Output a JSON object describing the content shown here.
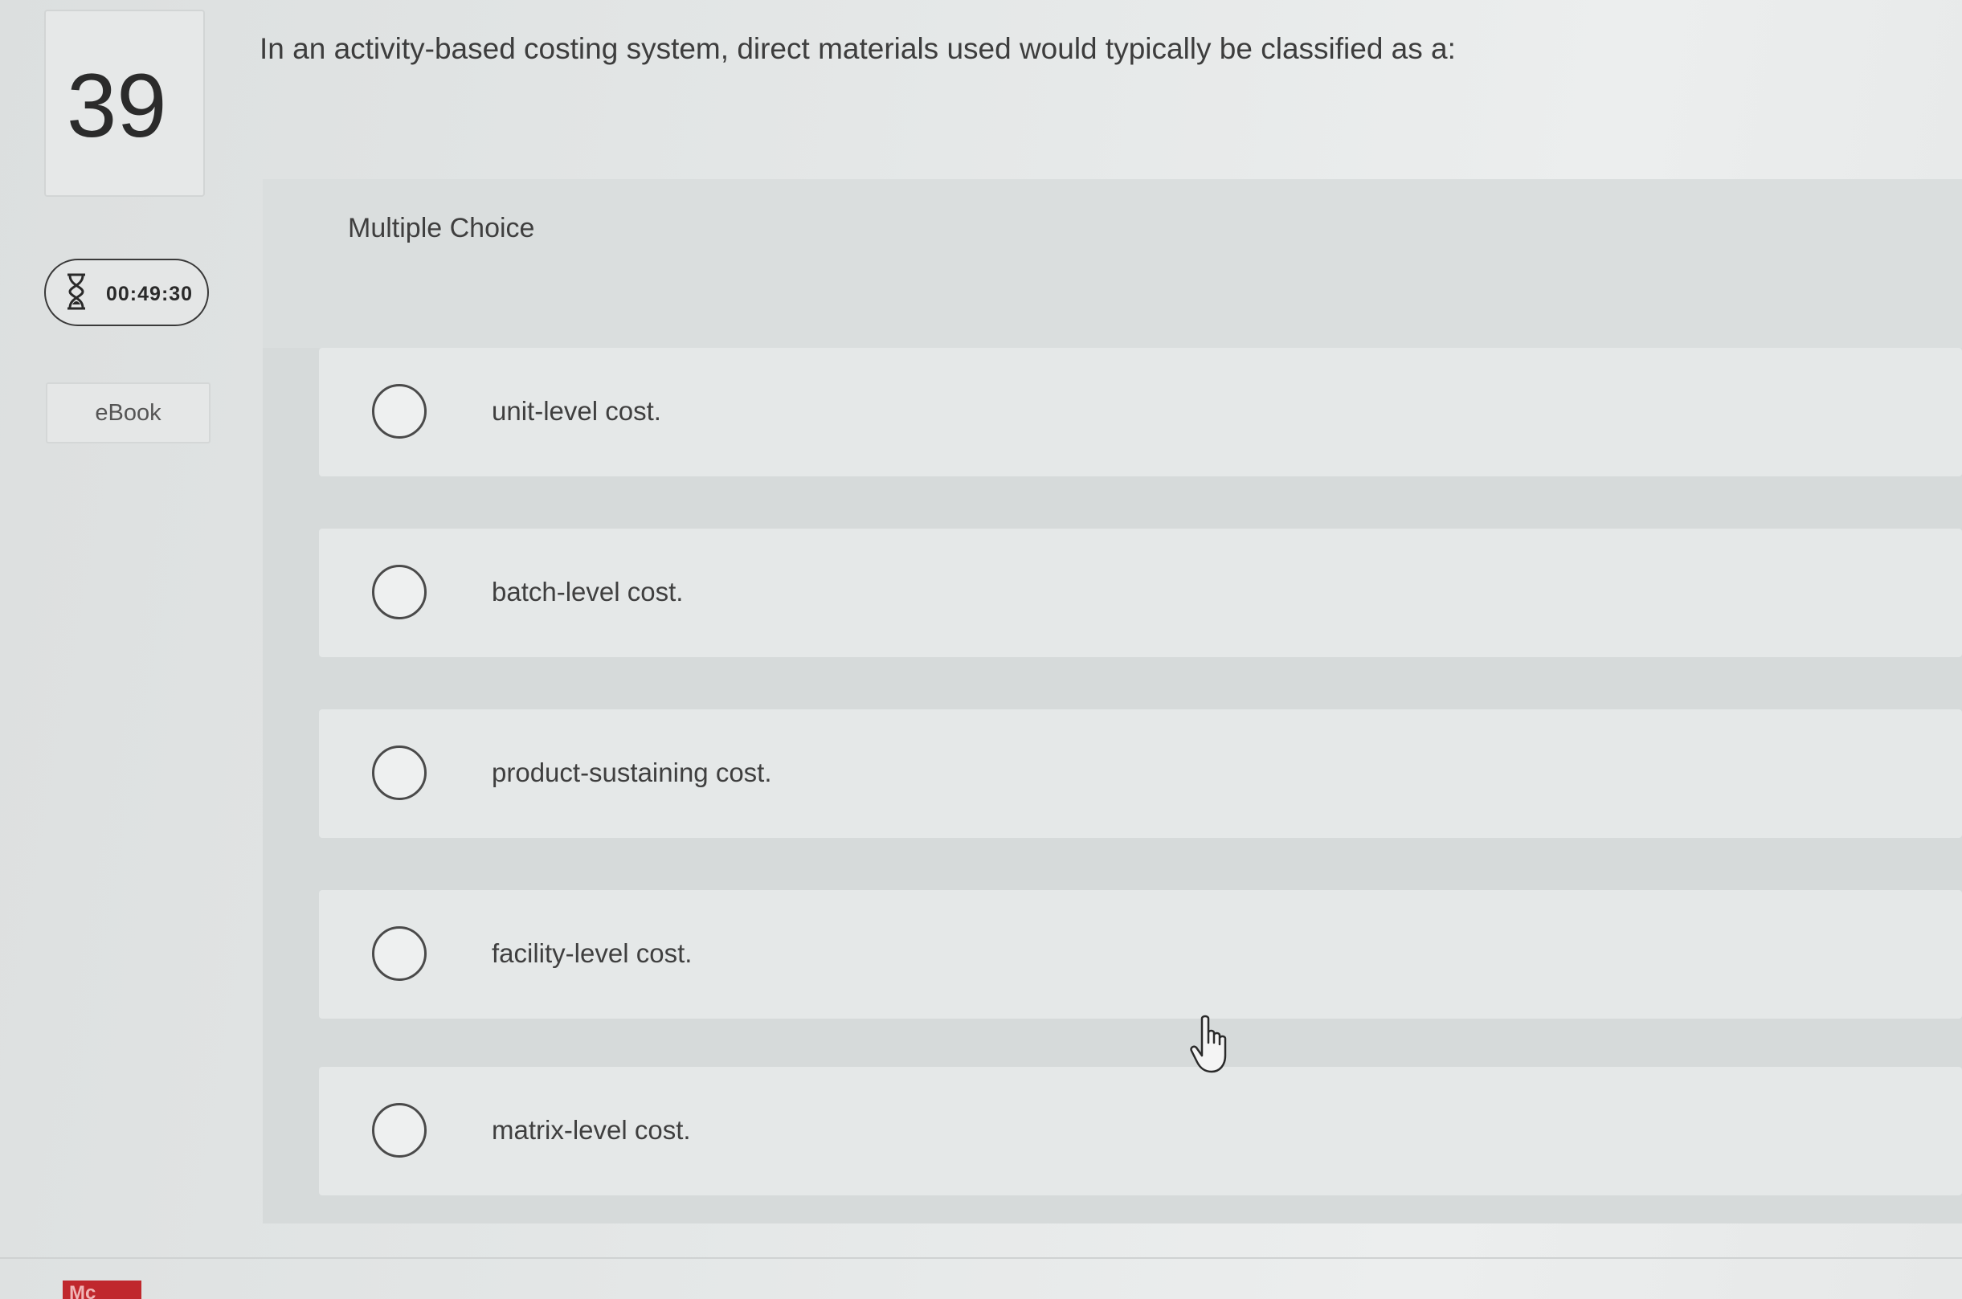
{
  "question": {
    "number": "39",
    "text": "In an activity-based costing system, direct materials used would typically be classified as a:"
  },
  "timer": {
    "icon": "hourglass-icon",
    "value": "00:49:30"
  },
  "ebook": {
    "label": "eBook"
  },
  "answer_panel": {
    "type_label": "Multiple Choice",
    "choices": [
      {
        "label": "unit-level cost."
      },
      {
        "label": "batch-level cost."
      },
      {
        "label": "product-sustaining cost."
      },
      {
        "label": "facility-level cost."
      },
      {
        "label": "matrix-level cost."
      }
    ]
  },
  "footer": {
    "logo_text": "Mc"
  },
  "colors": {
    "background": "#e3e6e6",
    "panel": "#d6dada",
    "choice_row": "#e5e8e8",
    "logo_red": "#c0282d"
  }
}
